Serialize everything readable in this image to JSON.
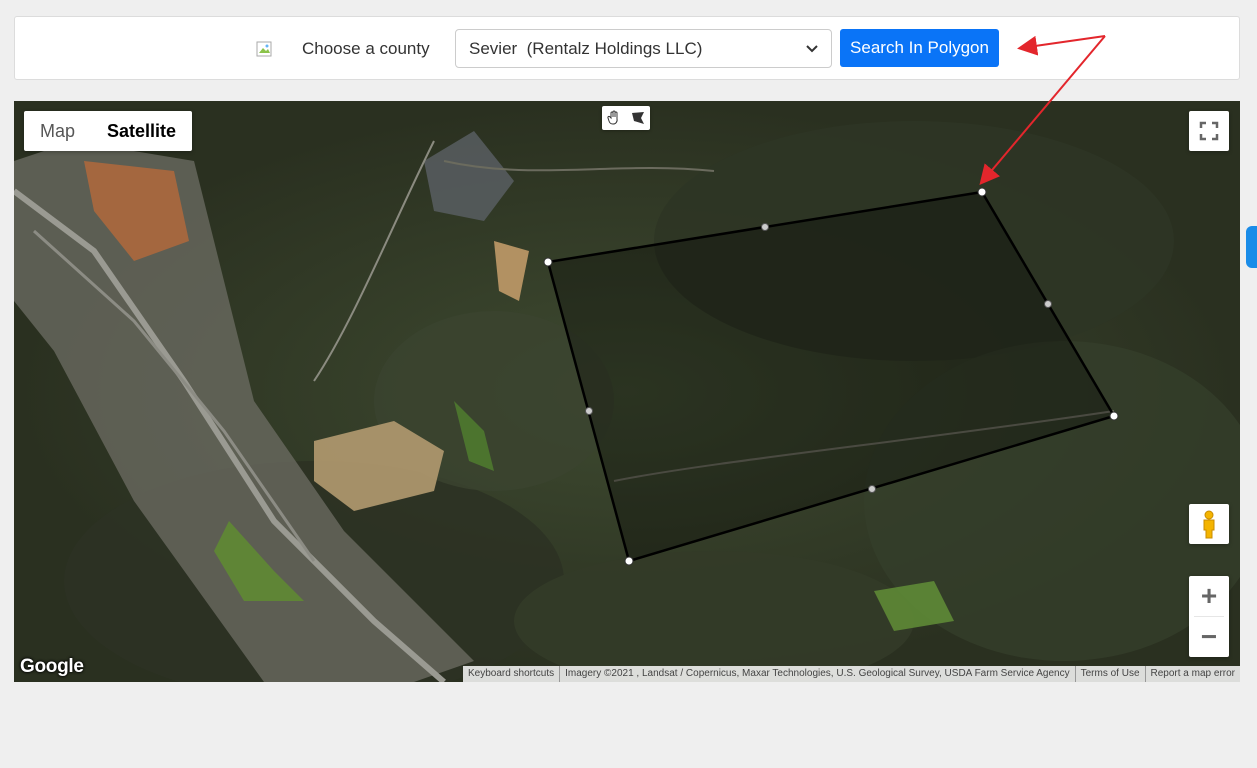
{
  "toolbar": {
    "county_label": "Choose a county",
    "county_selected": "Sevier  (Rentalz Holdings LLC)",
    "search_button_label": "Search In Polygon"
  },
  "map": {
    "type_control": {
      "map_label": "Map",
      "satellite_label": "Satellite",
      "active": "Satellite"
    },
    "drawing_tools": [
      "hand-icon",
      "polygon-icon"
    ],
    "zoom_in_label": "+",
    "zoom_out_label": "−",
    "logo_text": "Google",
    "attribution": {
      "keyboard": "Keyboard shortcuts",
      "imagery": "Imagery ©2021 , Landsat / Copernicus, Maxar Technologies, U.S. Geological Survey, USDA Farm Service Agency",
      "terms": "Terms of Use",
      "report": "Report a map error"
    }
  },
  "colors": {
    "accent": "#0a74f7",
    "annotation_arrow": "#e3262c",
    "polygon_stroke": "#000000"
  }
}
